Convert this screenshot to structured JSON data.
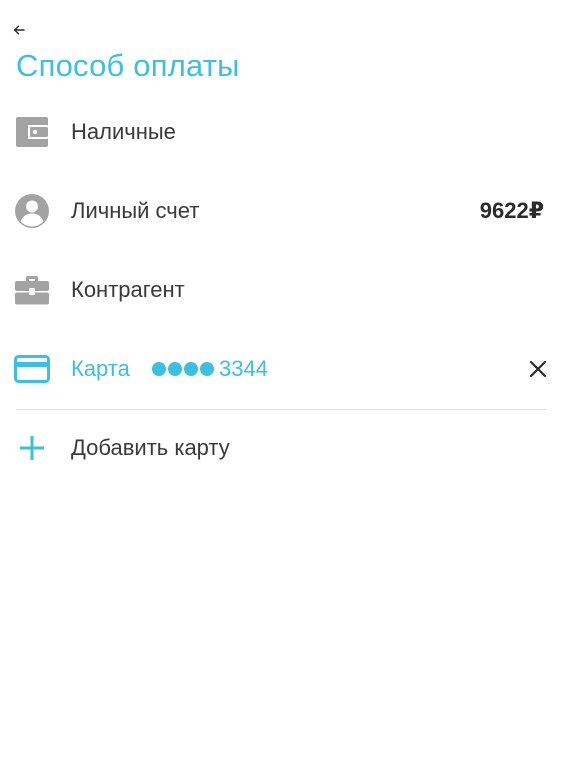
{
  "header": {
    "title": "Способ оплаты"
  },
  "payment_methods": [
    {
      "label": "Наличные",
      "icon": "wallet-icon"
    },
    {
      "label": "Личный счет",
      "icon": "account-icon",
      "balance": "9622₽"
    },
    {
      "label": "Контрагент",
      "icon": "briefcase-icon"
    },
    {
      "label": "Карта",
      "icon": "credit-card-icon",
      "masked_dots": "●●●●",
      "card_last4": "3344",
      "selected": true
    }
  ],
  "add_card": {
    "label": "Добавить карту",
    "icon": "plus-icon"
  },
  "colors": {
    "accent": "#3bbfe2",
    "icon_gray": "#a3a3a3",
    "text": "#3a3a3a"
  }
}
